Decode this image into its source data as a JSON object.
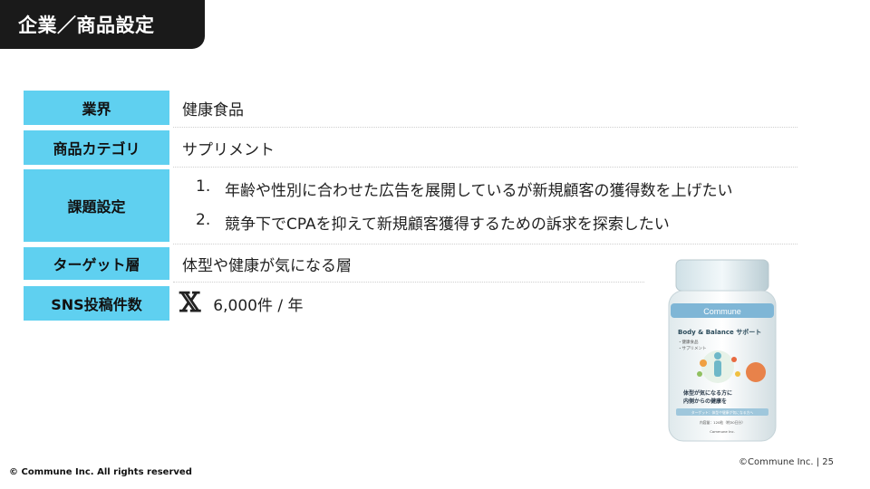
{
  "header": {
    "title": "企業／商品設定"
  },
  "table": {
    "industry": {
      "label": "業界",
      "value": "健康食品"
    },
    "category": {
      "label": "商品カテゴリ",
      "value": "サプリメント"
    },
    "issues": {
      "label": "課題設定",
      "items": [
        {
          "num": "1.",
          "text": "年齢や性別に合わせた広告を展開しているが新規顧客の獲得数を上げたい"
        },
        {
          "num": "2.",
          "text": "競争下でCPAを抑えて新規顧客獲得するための訴求を探索したい"
        }
      ]
    },
    "target": {
      "label": "ターゲット層",
      "value": "体型や健康が気になる層"
    },
    "sns": {
      "label": "SNS投稿件数",
      "icon": "x-logo-icon",
      "value": "6,000件 / 年"
    }
  },
  "product": {
    "brand": "Commune",
    "name": "Body & Balance サポート",
    "sub1": "・健康食品",
    "sub2": "・サプリメント",
    "tagline1": "体型が気になる方に",
    "tagline2": "内側からの健康を",
    "target_strip": "ターゲット：体型や健康が気になる方へ",
    "content": "内容量：120粒（約30日分）",
    "maker": "Commune Inc."
  },
  "footer": {
    "copyright": "© Commune Inc. All rights reserved",
    "page": "©Commune Inc.  |  25"
  }
}
